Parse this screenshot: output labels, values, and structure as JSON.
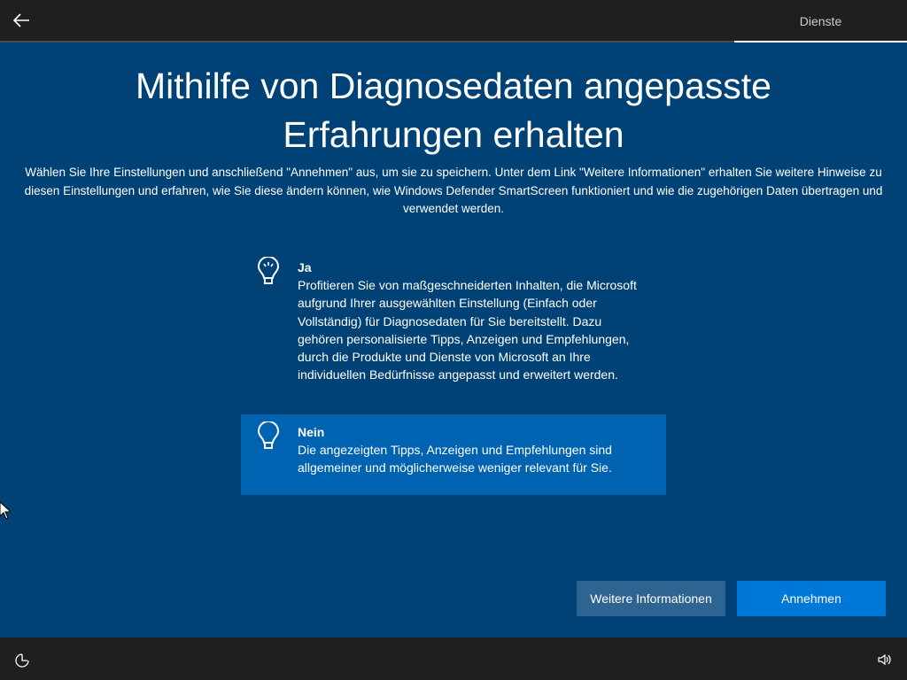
{
  "header": {
    "step_label": "Dienste"
  },
  "title": "Mithilfe von Diagnosedaten angepasste Erfahrungen erhalten",
  "description": "Wählen Sie Ihre Einstellungen und anschließend \"Annehmen\" aus, um sie zu speichern. Unter dem Link \"Weitere Informationen\" erhalten Sie weitere Hinweise zu diesen Einstellungen und erfahren, wie Sie diese ändern können, wie Windows Defender SmartScreen funktioniert und wie die zugehörigen Daten übertragen und verwendet werden.",
  "options": [
    {
      "label": "Ja",
      "text": "Profitieren Sie von maßgeschneiderten Inhalten, die Microsoft aufgrund Ihrer ausgewählten Einstellung (Einfach oder Vollständig) für Diagnosedaten für Sie bereitstellt. Dazu gehören personalisierte Tipps, Anzeigen und Empfehlungen, durch die Produkte und Dienste von Microsoft an Ihre individuellen Bedürfnisse angepasst und erweitert werden.",
      "icon": "lightbulb-on-icon",
      "selected": false
    },
    {
      "label": "Nein",
      "text": "Die angezeigten Tipps, Anzeigen und Empfehlungen sind allgemeiner und möglicherweise weniger relevant für Sie.",
      "icon": "lightbulb-off-icon",
      "selected": true
    }
  ],
  "buttons": {
    "more_info": "Weitere Informationen",
    "accept": "Annehmen"
  },
  "colors": {
    "background": "#004275",
    "selected": "#0063b1",
    "accent": "#0078d7",
    "bar": "#1f1f1f"
  }
}
